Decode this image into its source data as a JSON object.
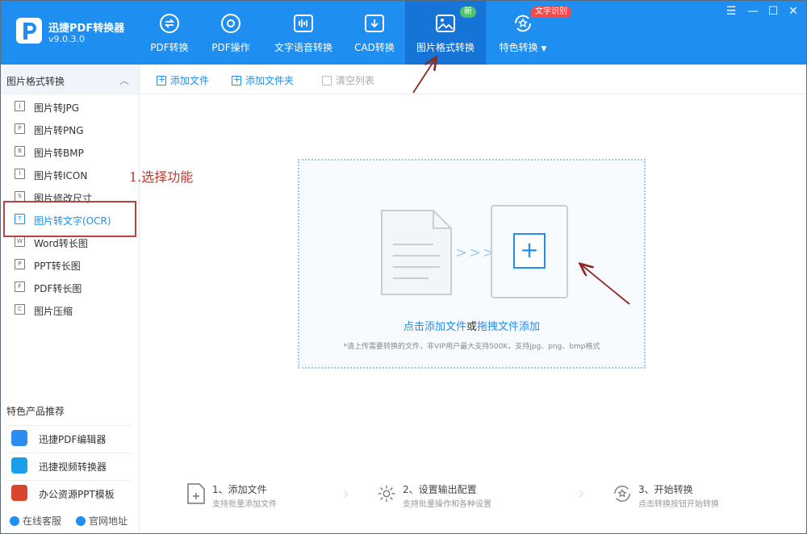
{
  "app": {
    "name": "迅捷PDF转换器",
    "version": "v9.0.3.0"
  },
  "nav": {
    "tabs": [
      {
        "label": "PDF转换"
      },
      {
        "label": "PDF操作"
      },
      {
        "label": "文字语音转换"
      },
      {
        "label": "CAD转换"
      },
      {
        "label": "图片格式转换",
        "badge": "新"
      },
      {
        "label": "特色转换",
        "badge": "文字识别"
      }
    ],
    "active_tab": "图片格式转换"
  },
  "window_controls": {
    "menu": "☰",
    "minimize": "—",
    "maximize": "☐",
    "close": "✕"
  },
  "sidebar": {
    "title": "图片格式转换",
    "collapse_glyph": "︿",
    "items": [
      {
        "label": "图片转JPG",
        "icon": "J"
      },
      {
        "label": "图片转PNG",
        "icon": "P"
      },
      {
        "label": "图片转BMP",
        "icon": "B"
      },
      {
        "label": "图片转ICON",
        "icon": "I"
      },
      {
        "label": "图片修改尺寸",
        "icon": "S"
      },
      {
        "label": "图片转文字(OCR)",
        "icon": "T"
      },
      {
        "label": "Word转长图",
        "icon": "W"
      },
      {
        "label": "PPT转长图",
        "icon": "P"
      },
      {
        "label": "PDF转长图",
        "icon": "F"
      },
      {
        "label": "图片压缩",
        "icon": "C"
      }
    ],
    "selected_item": "图片转文字(OCR)",
    "recommend_title": "特色产品推荐",
    "recommend": [
      {
        "label": "迅捷PDF编辑器",
        "color": "#2d8cf0"
      },
      {
        "label": "迅捷视频转换器",
        "color": "#1aa0e8"
      },
      {
        "label": "办公资源PPT模板",
        "color": "#d9452f"
      }
    ],
    "footer": {
      "service": "在线客服",
      "website": "官网地址"
    }
  },
  "toolbar": {
    "add_file": "添加文件",
    "add_folder": "添加文件夹",
    "clear_list": "清空列表"
  },
  "annotation": {
    "step_note": "1.选择功能"
  },
  "dropzone": {
    "chevrons": ">>>",
    "plus": "+",
    "text_click": "点击添加文件",
    "text_or": "或",
    "text_drag": "拖拽文件添加",
    "hint": "*请上传需要转换的文件，非VIP用户最大支持500K，支持jpg、png、bmp格式"
  },
  "steps": [
    {
      "title": "1、添加文件",
      "sub": "支持批量添加文件"
    },
    {
      "title": "2、设置输出配置",
      "sub": "支持批量操作和各种设置"
    },
    {
      "title": "3、开始转换",
      "sub": "点击转换按钮开始转换"
    }
  ],
  "colors": {
    "primary": "#1f8ef1",
    "active_tab": "#1574d6",
    "annotation": "#b9433b"
  }
}
